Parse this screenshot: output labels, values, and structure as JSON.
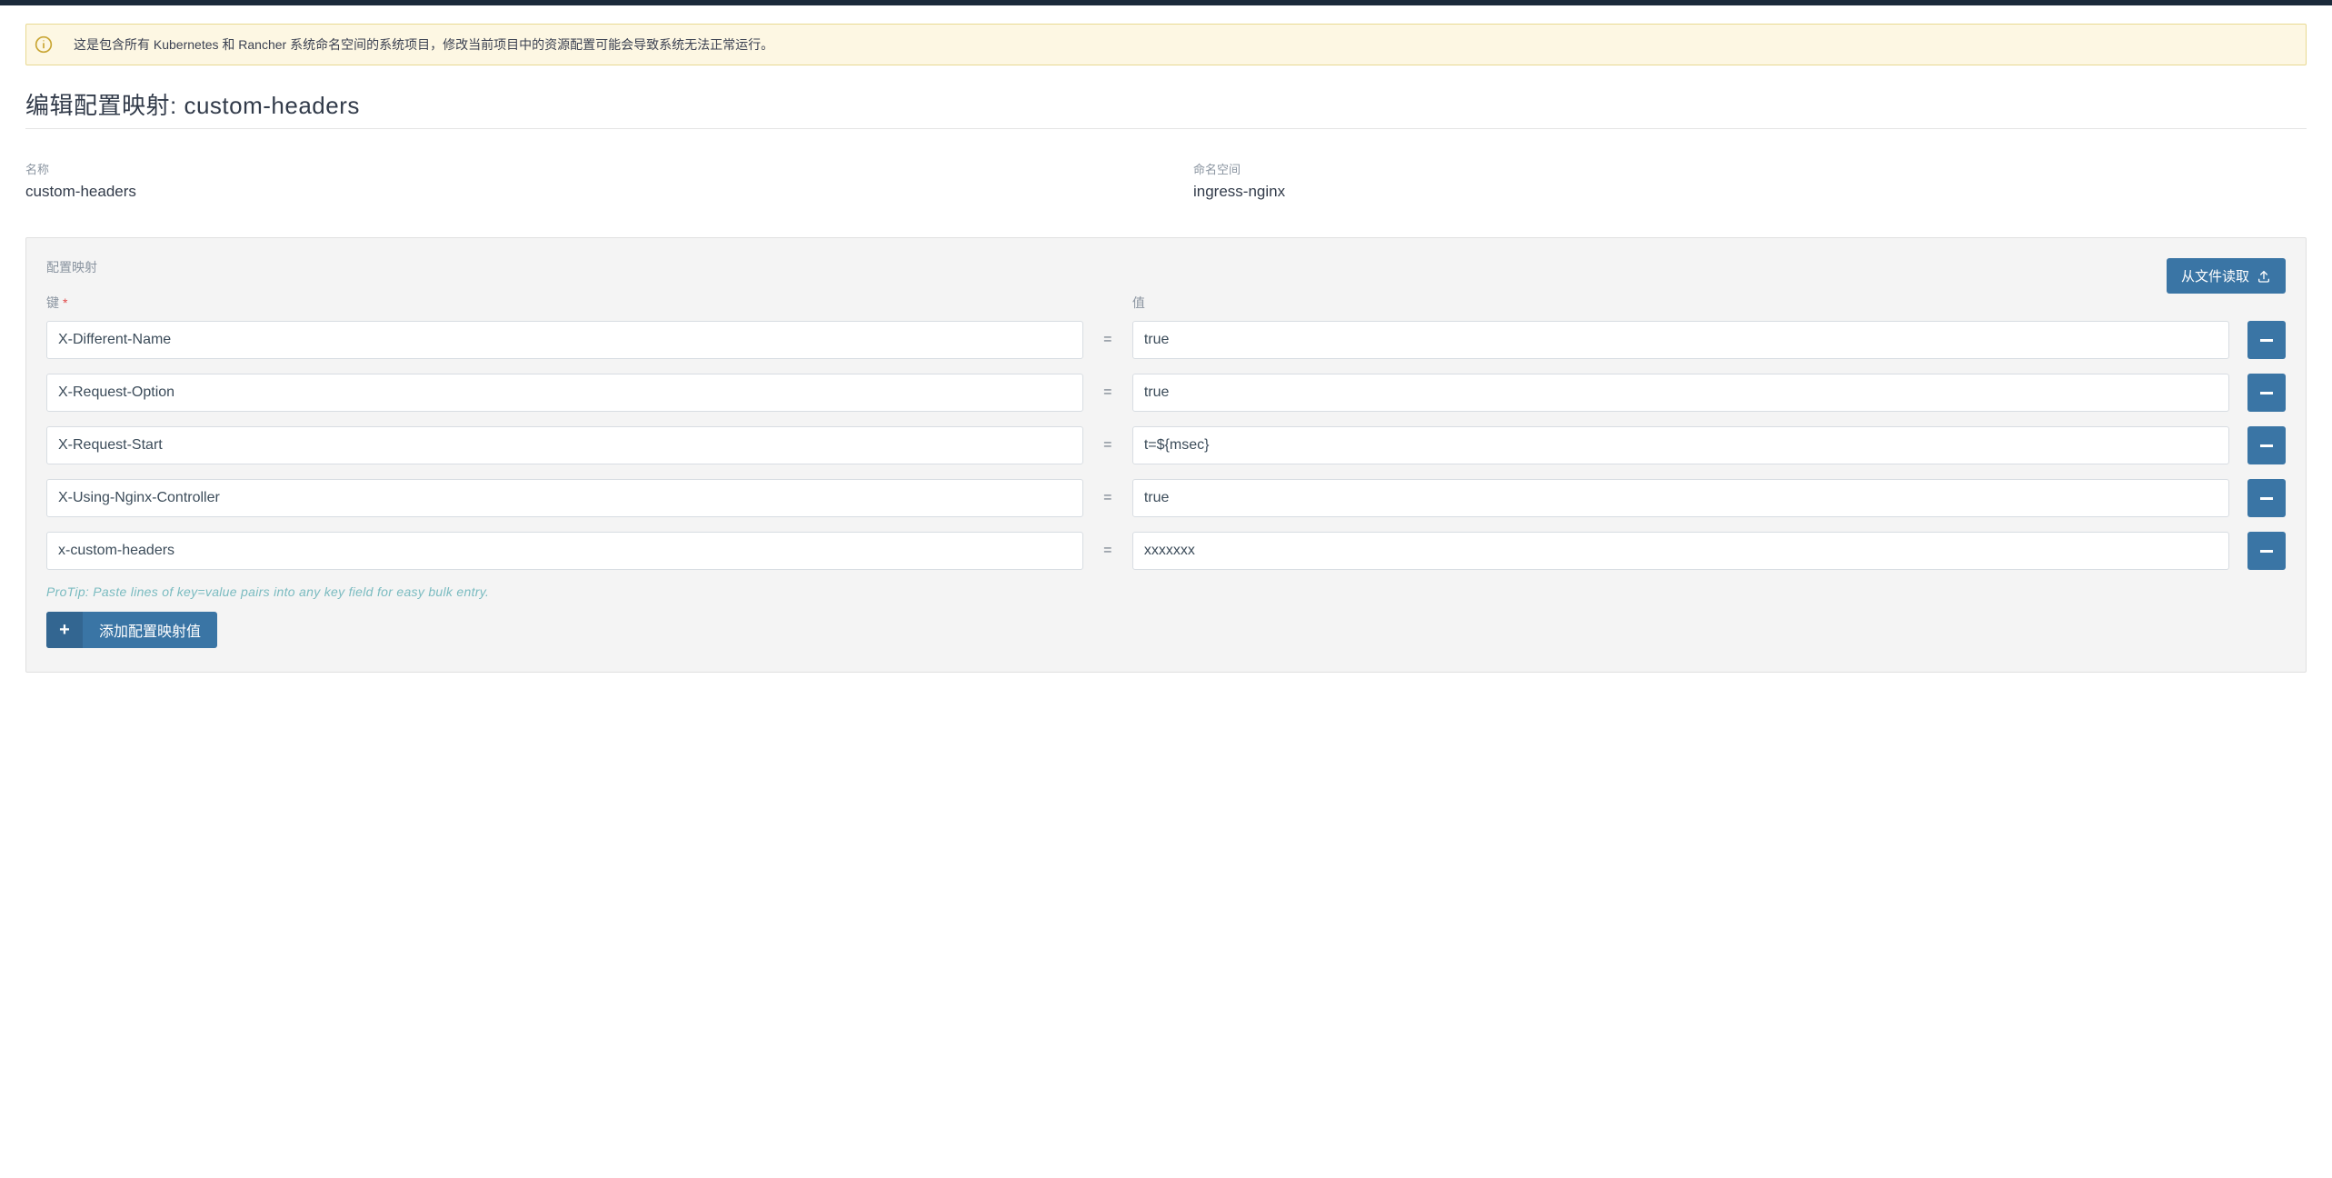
{
  "banner": {
    "text": "这是包含所有 Kubernetes 和 Rancher 系统命名空间的系统项目，修改当前项目中的资源配置可能会导致系统无法正常运行。"
  },
  "page": {
    "title_prefix": "编辑配置映射: ",
    "title_name": "custom-headers"
  },
  "meta": {
    "name_label": "名称",
    "name_value": "custom-headers",
    "ns_label": "命名空间",
    "ns_value": "ingress-nginx"
  },
  "panel": {
    "section_label": "配置映射",
    "key_header": "键",
    "value_header": "值",
    "file_button": "从文件读取",
    "protip": "ProTip: Paste lines of key=value pairs into any key field for easy bulk entry.",
    "add_button": "添加配置映射值"
  },
  "rows": [
    {
      "key": "X-Different-Name",
      "value": "true"
    },
    {
      "key": "X-Request-Option",
      "value": "true"
    },
    {
      "key": "X-Request-Start",
      "value": "t=${msec}"
    },
    {
      "key": "X-Using-Nginx-Controller",
      "value": "true"
    },
    {
      "key": "x-custom-headers",
      "value": "xxxxxxx"
    }
  ]
}
